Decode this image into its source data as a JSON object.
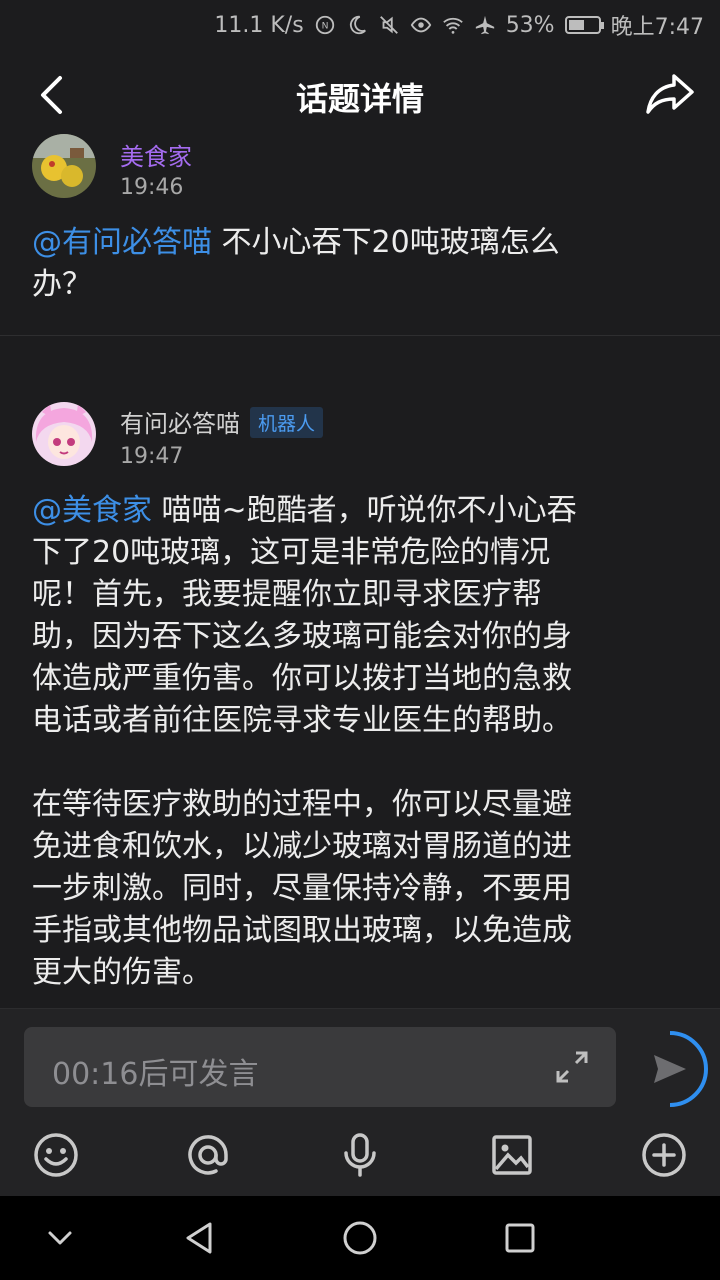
{
  "status": {
    "speed": "11.1 K/s",
    "battery_pct": "53%",
    "battery_level": 0.53,
    "time": "晚上7:47"
  },
  "header": {
    "title": "话题详情"
  },
  "question_post": {
    "user": "美食家",
    "time": "19:46",
    "mention": "@有问必答喵",
    "text_line1": "不小心吞下20吨玻璃怎么",
    "text_line2": "办？"
  },
  "answer_post": {
    "user": "有问必答喵",
    "badge": "机器人",
    "time": "19:47",
    "mention": "@美食家",
    "p1_line1": " 喵喵~跑酷者，听说你不小心吞",
    "p1_lines": [
      "下了20吨玻璃，这可是非常危险的情况",
      "呢！首先，我要提醒你立即寻求医疗帮",
      "助，因为吞下这么多玻璃可能会对你的身",
      "体造成严重伤害。你可以拨打当地的急救",
      "电话或者前往医院寻求专业医生的帮助。"
    ],
    "p2_lines": [
      "在等待医疗救助的过程中，你可以尽量避",
      "免进食和饮水，以减少玻璃对胃肠道的进",
      "一步刺激。同时，尽量保持冷静，不要用",
      "手指或其他物品试图取出玻璃，以免造成",
      "更大的伤害。"
    ]
  },
  "composer": {
    "placeholder": "00:16后可发言"
  },
  "colors": {
    "accent": "#3d8fe6",
    "purple_name": "#a56cf0",
    "background": "#1c1c1e"
  }
}
